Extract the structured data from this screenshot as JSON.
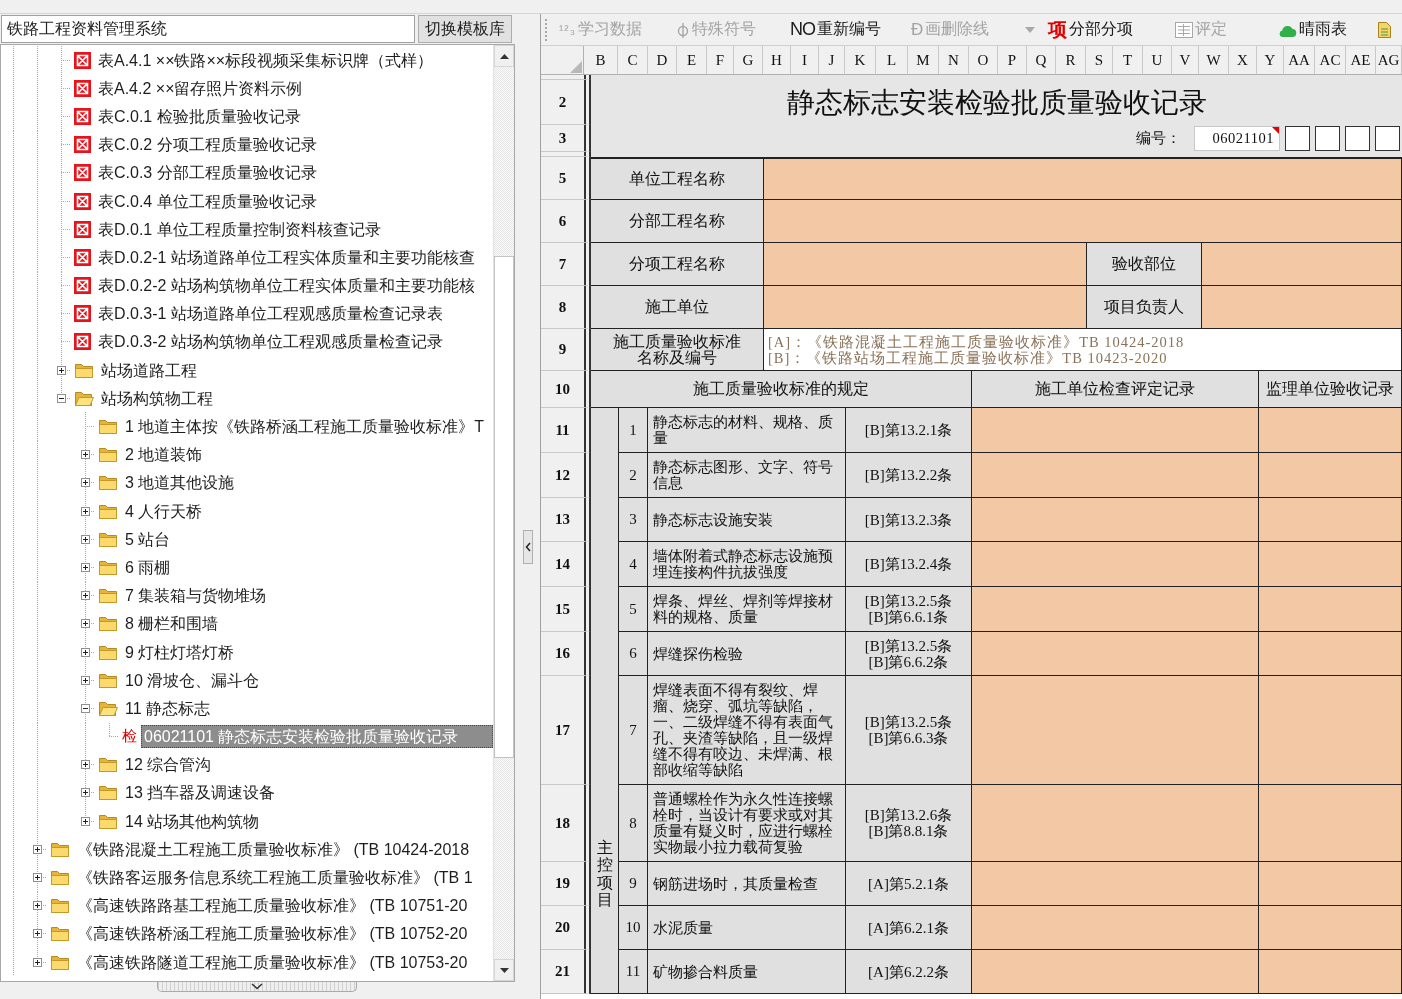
{
  "left_panel": {
    "title": "铁路工程资料管理系统",
    "switch_button": "切换模板库"
  },
  "tree": {
    "items": [
      {
        "children": [
          {
            "children": [
              {
                "kind": "table",
                "label": "表A.4.1 ××铁路××标段视频采集标识牌（式样）",
                "selected": false
              },
              {
                "kind": "table",
                "label": "表A.4.2 ××留存照片资料示例",
                "selected": false
              },
              {
                "kind": "table",
                "label": "表C.0.1 检验批质量验收记录",
                "selected": false
              },
              {
                "kind": "table",
                "label": "表C.0.2 分项工程质量验收记录",
                "selected": false
              },
              {
                "kind": "table",
                "label": "表C.0.3 分部工程质量验收记录",
                "selected": false
              },
              {
                "kind": "table",
                "label": "表C.0.4 单位工程质量验收记录",
                "selected": false
              },
              {
                "kind": "table",
                "label": "表D.0.1 单位工程质量控制资料核查记录",
                "selected": false
              },
              {
                "kind": "table",
                "label": "表D.0.2-1 站场道路单位工程实体质量和主要功能核查",
                "selected": false
              },
              {
                "kind": "table",
                "label": "表D.0.2-2 站场构筑物单位工程实体质量和主要功能核",
                "selected": false
              },
              {
                "kind": "table",
                "label": "表D.0.3-1 站场道路单位工程观感质量检查记录表",
                "selected": false
              },
              {
                "kind": "table",
                "label": "表D.0.3-2 站场构筑物单位工程观感质量检查记录",
                "selected": false
              },
              {
                "kind": "folder",
                "label": "站场道路工程",
                "expanded": false,
                "selected": false
              },
              {
                "kind": "folder",
                "label": "站场构筑物工程",
                "expanded": true,
                "selected": false,
                "children": [
                  {
                    "kind": "folder",
                    "label": "1 地道主体按《铁路桥涵工程施工质量验收标准》T",
                    "selected": false
                  },
                  {
                    "kind": "folder",
                    "label": "2 地道装饰",
                    "expanded": false,
                    "selected": false
                  },
                  {
                    "kind": "folder",
                    "label": "3 地道其他设施",
                    "expanded": false,
                    "selected": false
                  },
                  {
                    "kind": "folder",
                    "label": "4 人行天桥",
                    "expanded": false,
                    "selected": false
                  },
                  {
                    "kind": "folder",
                    "label": "5 站台",
                    "expanded": false,
                    "selected": false
                  },
                  {
                    "kind": "folder",
                    "label": "6 雨棚",
                    "expanded": false,
                    "selected": false
                  },
                  {
                    "kind": "folder",
                    "label": "7 集装箱与货物堆场",
                    "expanded": false,
                    "selected": false
                  },
                  {
                    "kind": "folder",
                    "label": "8 栅栏和围墙",
                    "expanded": false,
                    "selected": false
                  },
                  {
                    "kind": "folder",
                    "label": "9 灯柱灯塔灯桥",
                    "expanded": false,
                    "selected": false
                  },
                  {
                    "kind": "folder",
                    "label": "10 滑坡仓、漏斗仓",
                    "expanded": false,
                    "selected": false
                  },
                  {
                    "kind": "folder",
                    "label": "11 静态标志",
                    "expanded": true,
                    "selected": false,
                    "children": [
                      {
                        "kind": "record",
                        "badge": "检",
                        "label": "06021101 静态标志安装检验批质量验收记录",
                        "selected": true
                      }
                    ]
                  },
                  {
                    "kind": "folder",
                    "label": "12 综合管沟",
                    "expanded": false,
                    "selected": false
                  },
                  {
                    "kind": "folder",
                    "label": "13 挡车器及调速设备",
                    "expanded": false,
                    "selected": false
                  },
                  {
                    "kind": "folder",
                    "label": "14 站场其他构筑物",
                    "expanded": false,
                    "selected": false
                  }
                ]
              }
            ]
          },
          {
            "kind": "folder",
            "label": "《铁路混凝土工程施工质量验收标准》 (TB 10424-2018",
            "expanded": false,
            "selected": false
          },
          {
            "kind": "folder",
            "label": "《铁路客运服务信息系统工程施工质量验收标准》 (TB 1",
            "expanded": false,
            "selected": false
          },
          {
            "kind": "folder",
            "label": "《高速铁路路基工程施工质量验收标准》 (TB 10751-20",
            "expanded": false,
            "selected": false
          },
          {
            "kind": "folder",
            "label": "《高速铁路桥涵工程施工质量验收标准》 (TB 10752-20",
            "expanded": false,
            "selected": false
          },
          {
            "kind": "folder",
            "label": "《高速铁路隧道工程施工质量验收标准》 (TB 10753-20",
            "expanded": false,
            "selected": false
          }
        ]
      }
    ]
  },
  "toolbar": {
    "buttons": [
      {
        "kind": "numbering",
        "glyph": "¹²₃",
        "label": "学习数据",
        "disabled": true
      },
      {
        "kind": "symbol",
        "label": "特殊符号",
        "disabled": true
      },
      {
        "kind": "renumber",
        "glyph": "NO",
        "label": "重新编号",
        "disabled": false
      },
      {
        "kind": "strike",
        "glyph": "Đ",
        "label": "画删除线",
        "disabled": true
      },
      {
        "kind": "dropdown",
        "disabled": true
      },
      {
        "kind": "section",
        "glyph": "项",
        "label": "分部分项",
        "disabled": false
      },
      {
        "kind": "grade",
        "label": "评定",
        "disabled": true
      },
      {
        "kind": "weather",
        "label": "晴雨表",
        "disabled": false
      },
      {
        "kind": "document",
        "disabled": false
      }
    ]
  },
  "sheet": {
    "columns": [
      "B",
      "C",
      "D",
      "E",
      "F",
      "G",
      "H",
      "I",
      "J",
      "K",
      "L",
      "M",
      "N",
      "O",
      "P",
      "Q",
      "R",
      "S",
      "T",
      "U",
      "V",
      "W",
      "X",
      "Y",
      "AA",
      "AC",
      "AE",
      "AG"
    ],
    "rows": [
      {
        "kind": "collapsed"
      },
      {
        "kind": "title",
        "number": "2",
        "text": "静态标志安装检验批质量验收记录"
      },
      {
        "kind": "code",
        "number": "3",
        "caption": "编号：",
        "code": "06021101",
        "comment": true,
        "digit_boxes": [
          {
            "kind": "blank"
          },
          {
            "kind": "blank"
          },
          {
            "kind": "blank"
          },
          {
            "kind": "blank"
          }
        ]
      },
      {
        "kind": "collapsed"
      },
      {
        "kind": "field",
        "number": "5",
        "label": "单位工程名称"
      },
      {
        "kind": "field",
        "number": "6",
        "label": "分部工程名称"
      },
      {
        "kind": "field_pair",
        "number": "7",
        "label": "分项工程名称",
        "label_2": "验收部位"
      },
      {
        "kind": "field_pair",
        "number": "8",
        "label": "施工单位",
        "label_2": "项目负责人"
      },
      {
        "kind": "standards",
        "number": "9",
        "label": "施工质量验收标准名称及编号",
        "references": [
          "[A]：《铁路混凝土工程施工质量验收标准》TB 10424-2018",
          "[B]：《铁路站场工程施工质量验收标准》TB 10423-2020"
        ]
      },
      {
        "kind": "header",
        "number": "10",
        "headings": [
          "施工质量验收标准的规定",
          "施工单位检查评定记录",
          "监理单位验收记录"
        ]
      },
      {
        "kind": "group",
        "category": "主控项目",
        "rows": [
          {
            "number": "11",
            "index": "1",
            "description": "静态标志的材料、规格、质量",
            "clauses": [
              "[B]第13.2.1条"
            ]
          },
          {
            "number": "12",
            "index": "2",
            "description": "静态标志图形、文字、符号信息",
            "clauses": [
              "[B]第13.2.2条"
            ]
          },
          {
            "number": "13",
            "index": "3",
            "description": "静态标志设施安装",
            "clauses": [
              "[B]第13.2.3条"
            ]
          },
          {
            "number": "14",
            "index": "4",
            "description": "墙体附着式静态标志设施预埋连接构件抗拔强度",
            "clauses": [
              "[B]第13.2.4条"
            ]
          },
          {
            "number": "15",
            "index": "5",
            "description": "焊条、焊丝、焊剂等焊接材料的规格、质量",
            "clauses": [
              "[B]第13.2.5条",
              "[B]第6.6.1条"
            ]
          },
          {
            "number": "16",
            "index": "6",
            "description": "焊缝探伤检验",
            "clauses": [
              "[B]第13.2.5条",
              "[B]第6.6.2条"
            ]
          },
          {
            "number": "17",
            "index": "7",
            "description": "焊缝表面不得有裂纹、焊瘤、烧穿、弧坑等缺陷，一、二级焊缝不得有表面气孔、夹渣等缺陷，且一级焊缝不得有咬边、未焊满、根部收缩等缺陷",
            "clauses": [
              "[B]第13.2.5条",
              "[B]第6.6.3条"
            ]
          },
          {
            "number": "18",
            "index": "8",
            "description": "普通螺栓作为永久性连接螺栓时，当设计有要求或对其质量有疑义时，应进行螺栓实物最小拉力载荷复验",
            "clauses": [
              "[B]第13.2.6条",
              "[B]第8.8.1条"
            ]
          },
          {
            "number": "19",
            "index": "9",
            "description": "钢筋进场时，其质量检查",
            "clauses": [
              "[A]第5.2.1条"
            ]
          },
          {
            "number": "20",
            "index": "10",
            "description": "水泥质量",
            "clauses": [
              "[A]第6.2.1条"
            ]
          },
          {
            "number": "21",
            "index": "11",
            "description": "矿物掺合料质量",
            "clauses": [
              "[A]第6.2.2条"
            ]
          }
        ]
      }
    ]
  }
}
